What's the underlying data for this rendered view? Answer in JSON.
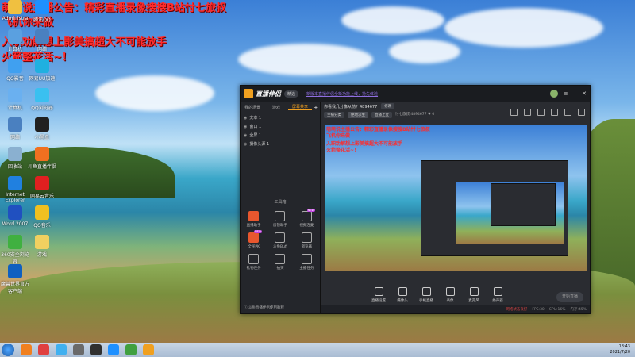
{
  "overlay": {
    "line1": "萌萌说主播公告：精彩直播录像搜搜B站忖七旅叔",
    "line2": "飞机你来做",
    "line3": "入职劝解想上影美搞超大不可能放手",
    "line4": "火箭整花活~！"
  },
  "desktop_icons": [
    {
      "label": "Administra",
      "color": "#f0c040"
    },
    {
      "label": "腾讯QQ",
      "color": "#1e90ff"
    },
    {
      "label": "计算机",
      "color": "#5aa0e0"
    },
    {
      "label": "网络",
      "color": "#4a80c0"
    },
    {
      "label": "QQ影音",
      "color": "#40a0f0"
    },
    {
      "label": "网易UU加速",
      "color": "#20b0e0"
    },
    {
      "label": "计算机",
      "color": "#6ab0f0"
    },
    {
      "label": "QQ浏览器",
      "color": "#3ac0f0"
    },
    {
      "label": "网络",
      "color": "#4a80c0"
    },
    {
      "label": "小黑盒",
      "color": "#202020"
    },
    {
      "label": "回收站",
      "color": "#8ab0d0"
    },
    {
      "label": "斗鱼直播伴侣",
      "color": "#f07020"
    },
    {
      "label": "Internet Explorer",
      "color": "#2080e0"
    },
    {
      "label": "网易云音乐",
      "color": "#e02020"
    },
    {
      "label": "Word 2007",
      "color": "#2050c0"
    },
    {
      "label": "QQ音乐",
      "color": "#f0c020"
    },
    {
      "label": "360安全浏览器",
      "color": "#40b040"
    },
    {
      "label": "游戏",
      "color": "#f0d060"
    },
    {
      "label": "魔兽世界官方客户端",
      "color": "#1060c0"
    }
  ],
  "app": {
    "name": "直播伴侣",
    "version_badge": "精选",
    "marquee": "新版本直播伴侣全新功能上线，抢先体验",
    "tabs": [
      "我的场景",
      "游戏",
      "屏幕共享"
    ],
    "active_tab": 2,
    "sources": [
      "文本 1",
      "窗口 1",
      "全屏 1",
      "摄像头源 1"
    ],
    "tools_title": "工具箱",
    "tools": [
      {
        "label": "直播助手",
        "hot": true,
        "new": false
      },
      {
        "label": "房管助手",
        "hot": false,
        "new": false
      },
      {
        "label": "视频连麦",
        "hot": false,
        "new": true
      },
      {
        "label": "全民PK",
        "hot": true,
        "new": true
      },
      {
        "label": "斗鱼Buff",
        "hot": false,
        "new": false
      },
      {
        "label": "浏览器",
        "hot": false,
        "new": false
      },
      {
        "label": "礼物任务",
        "hot": false,
        "new": false
      },
      {
        "label": "抽奖",
        "hot": false,
        "new": false
      },
      {
        "label": "主播任务",
        "hot": false,
        "new": false
      }
    ],
    "left_footer": "斗鱼直播伴侣使用教程",
    "room_title": "你看我几分像从前？4894677",
    "edit_label": "修改",
    "category_pills": [
      "主播分类",
      "绝地求生",
      "直播上麦"
    ],
    "room_meta": "忖七旅叔  4894677  ♥ 0",
    "bottom_buttons": [
      "直播设置",
      "摄像头",
      "手机直播",
      "录像",
      "麦克风",
      "扬声器"
    ],
    "go_live": "开始直播",
    "status_text": "网络状态良好",
    "status_extra": [
      "FPS:30",
      "CPU:16%",
      "内存:45%"
    ]
  },
  "taskbar": {
    "time": "18:43",
    "date": "2021/7/20",
    "apps": [
      {
        "color": "#f08020"
      },
      {
        "color": "#e04040"
      },
      {
        "color": "#40b0f0"
      },
      {
        "color": "#6a6a6a"
      },
      {
        "color": "#303030"
      },
      {
        "color": "#1e90ff"
      },
      {
        "color": "#40a040"
      },
      {
        "color": "#f0a020"
      }
    ]
  }
}
